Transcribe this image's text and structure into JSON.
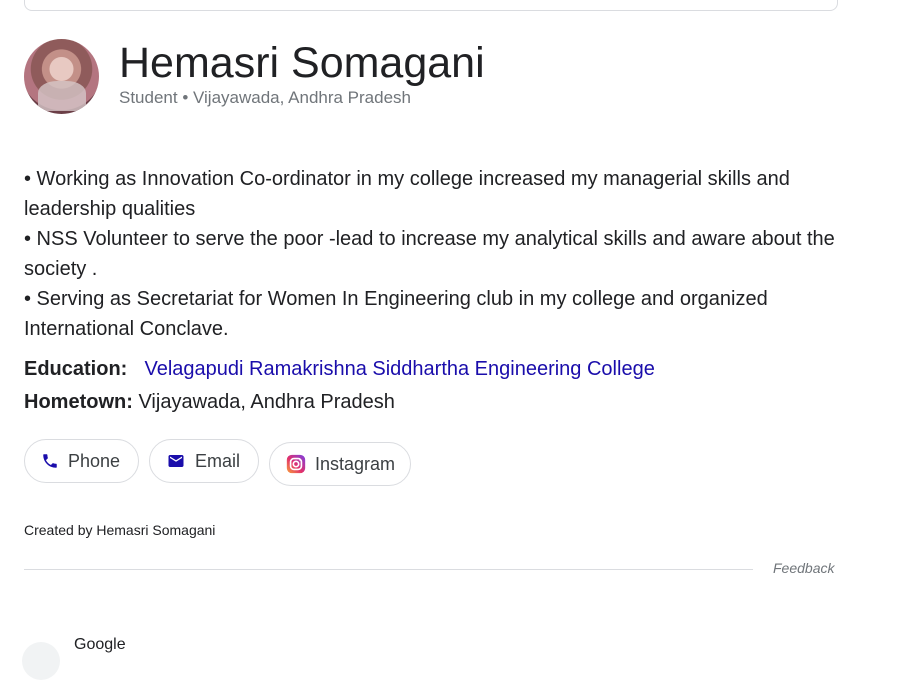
{
  "profile": {
    "name": "Hemasri Somagani",
    "subtitle": "Student • Vijayawada, Andhra Pradesh"
  },
  "bio": {
    "lines": [
      "• Working as Innovation Co-ordinator in my college increased my managerial skills and",
      "leadership qualities",
      "• NSS Volunteer to serve the poor -lead to increase my analytical skills and aware about the",
      "society .",
      "• Serving as Secretariat for Women In Engineering club in my college and organized",
      "International Conclave."
    ]
  },
  "facts": {
    "education_label": "Education:",
    "education_value": "Velagapudi Ramakrishna Siddhartha Engineering College",
    "hometown_label": "Hometown:",
    "hometown_value": "Vijayawada, Andhra Pradesh"
  },
  "actions": {
    "phone_label": "Phone",
    "email_label": "Email",
    "instagram_label": "Instagram"
  },
  "footer": {
    "created_by": "Created by Hemasri Somagani",
    "feedback": "Feedback"
  },
  "next_result": {
    "label": "Google"
  },
  "icons": {
    "phone": "phone-icon",
    "email": "mail-icon",
    "instagram": "instagram-icon"
  },
  "colors": {
    "link": "#1a0dab",
    "icon_blue": "#1a0dab",
    "muted": "#70757a",
    "border": "#dadce0"
  }
}
